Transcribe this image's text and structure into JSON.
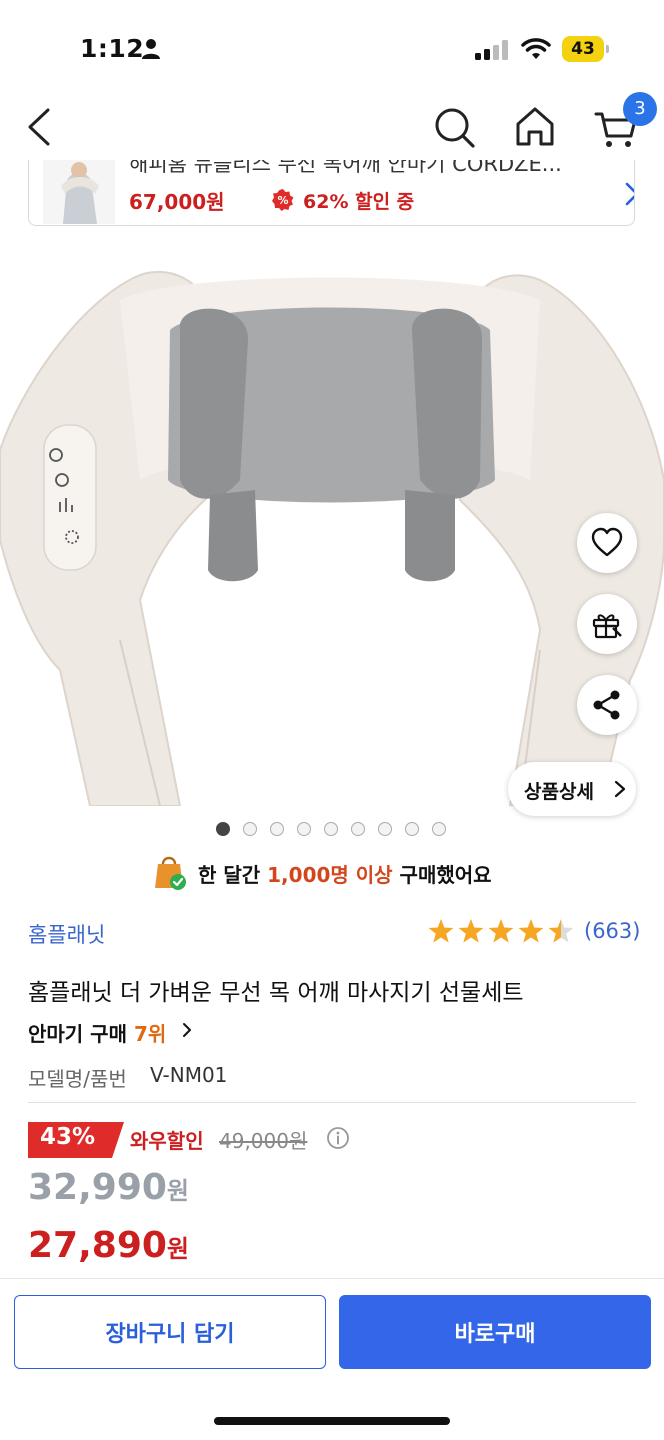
{
  "status": {
    "time": "1:12",
    "battery": "43"
  },
  "nav": {
    "cart_count": "3"
  },
  "recent": {
    "title": "해피홈 뉴블리스 무선 목어깨 안마기 CORDZE...",
    "price": "67,000원",
    "discount": "62% 할인 중"
  },
  "image": {
    "dots_total": 9,
    "active_dot": 1,
    "detail_label": "상품상세"
  },
  "purchase": {
    "prefix": "한 달간 ",
    "highlight": "1,000명 이상",
    "suffix": " 구매했어요"
  },
  "product": {
    "brand": "홈플래닛",
    "rating": 4.5,
    "review_count": "(663)",
    "title": "홈플래닛 더 가벼운 무선 목 어깨 마사지기 선물세트",
    "rank_prefix": "안마기 구매 ",
    "rank_num": "7위",
    "model_label": "모델명/품번",
    "model_value": "V-NM01"
  },
  "price": {
    "discount_pct": "43%",
    "wow_label": "와우할인",
    "original": "49,000원",
    "sale": "32,990",
    "wow_price": "27,890",
    "won": "원"
  },
  "buttons": {
    "cart": "장바구니 담기",
    "buy": "바로구매"
  },
  "colors": {
    "accent_blue": "#3366e8",
    "sale_red": "#cc1f1f",
    "rank_orange": "#e06a14",
    "star": "#f5a623"
  }
}
